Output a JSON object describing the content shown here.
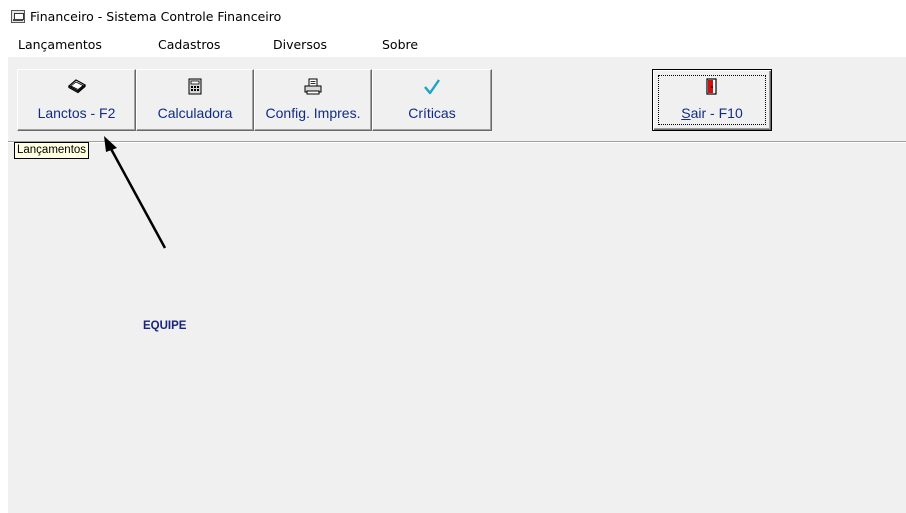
{
  "window": {
    "title": "Financeiro - Sistema Controle Financeiro"
  },
  "menu": [
    {
      "label": "Lançamentos"
    },
    {
      "label": "Cadastros"
    },
    {
      "label": "Diversos"
    },
    {
      "label": "Sobre"
    }
  ],
  "toolbar": {
    "buttons": [
      {
        "label": "Lanctos - F2",
        "icon": "book-icon"
      },
      {
        "label": "Calculadora",
        "icon": "calculator-icon"
      },
      {
        "label": "Config. Impres.",
        "icon": "printer-icon"
      },
      {
        "label": "Críticas",
        "icon": "checkmark-icon"
      }
    ],
    "exit_button": {
      "label_accel": "S",
      "label_rest": "air - F10",
      "icon": "exit-door-icon"
    }
  },
  "tooltip": {
    "text": "Lançamentos"
  },
  "body": {
    "equipe_label": "EQUIPE"
  },
  "colors": {
    "button_text": "#102c86",
    "equipe_text": "#1a237e",
    "client_bg": "#f0f0f0",
    "tooltip_bg": "#ffffe1",
    "check_icon": "#1aa3c8"
  }
}
